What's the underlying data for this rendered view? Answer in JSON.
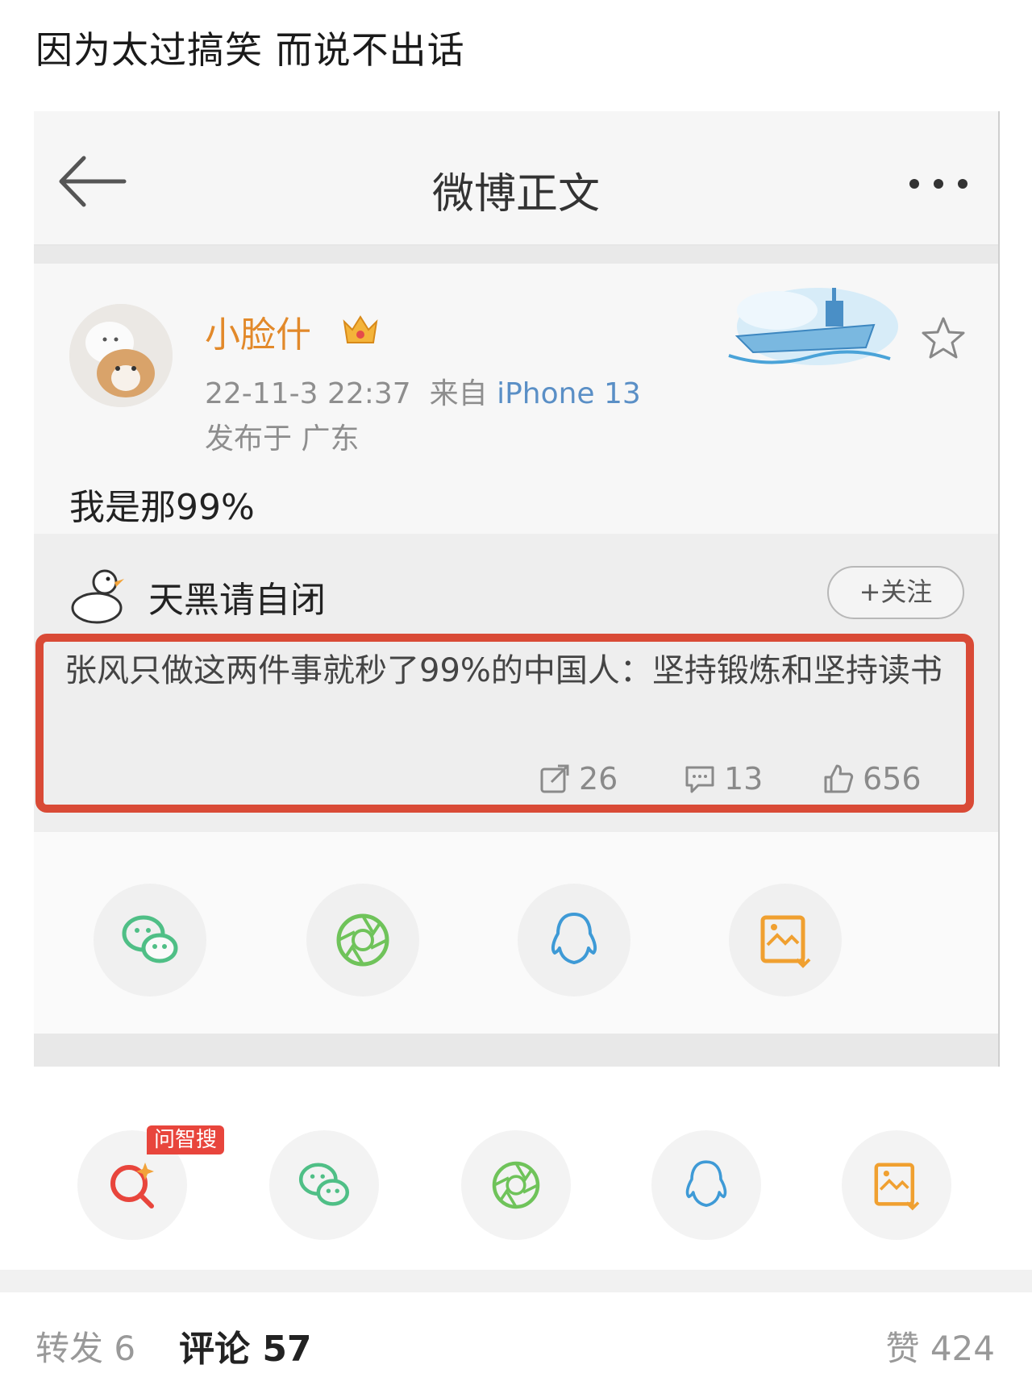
{
  "caption": "因为太过搞笑 而说不出话",
  "nav": {
    "title": "微博正文"
  },
  "post": {
    "username": "小脸什",
    "datetime": "22-11-3 22:37",
    "source_prefix": "来自",
    "device": "iPhone 13",
    "location": "发布于 广东",
    "text": "我是那99%"
  },
  "repost": {
    "username": "天黑请自闭",
    "follow_label": "+关注",
    "text": "张风只做这两件事就秒了99%的中国人：坚持锻炼和坚持读书",
    "stats": {
      "reposts": "26",
      "comments": "13",
      "likes": "656"
    }
  },
  "share_icons": [
    "wechat-icon",
    "moments-icon",
    "qq-icon",
    "save-image-icon"
  ],
  "bottom_share": {
    "ai_badge": "问智搜"
  },
  "footer": {
    "repost": "转发 6",
    "comment": "评论 57",
    "like": "赞 424"
  },
  "colors": {
    "username": "#e2892a",
    "device": "#5a8fc6",
    "highlight_box": "#d94a36",
    "wechat": "#4fbf86",
    "moments": "#6fc35a",
    "qq": "#3e9ad6",
    "save": "#f0a030",
    "ai": "#e8453c"
  }
}
